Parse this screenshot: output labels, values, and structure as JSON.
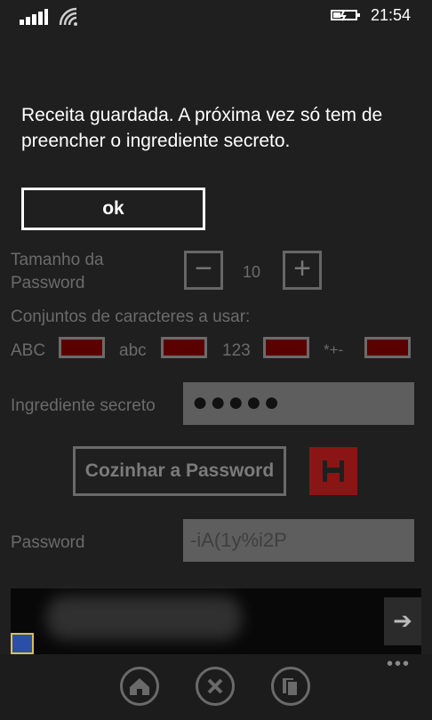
{
  "status": {
    "time": "21:54"
  },
  "dialog": {
    "message": "Receita guardada. A próxima vez só tem de preencher o ingrediente secreto.",
    "ok_label": "ok"
  },
  "form": {
    "length_label_line1": "Tamanho da",
    "length_label_line2": "Password",
    "length_value": "10",
    "minus_label": "−",
    "plus_label": "+",
    "charsets_label": "Conjuntos de caracteres a usar:",
    "charsets": [
      {
        "label": "ABC"
      },
      {
        "label": "abc"
      },
      {
        "label": "123"
      },
      {
        "label": "*+-"
      }
    ],
    "secret_label": "Ingrediente secreto",
    "secret_value": "●●●●●",
    "cook_button": "Cozinhar a Password",
    "password_label": "Password",
    "password_value": "-iA(1y%i2P"
  },
  "ad": {
    "arrow": "➔"
  },
  "appbar": {
    "more": "•••"
  }
}
